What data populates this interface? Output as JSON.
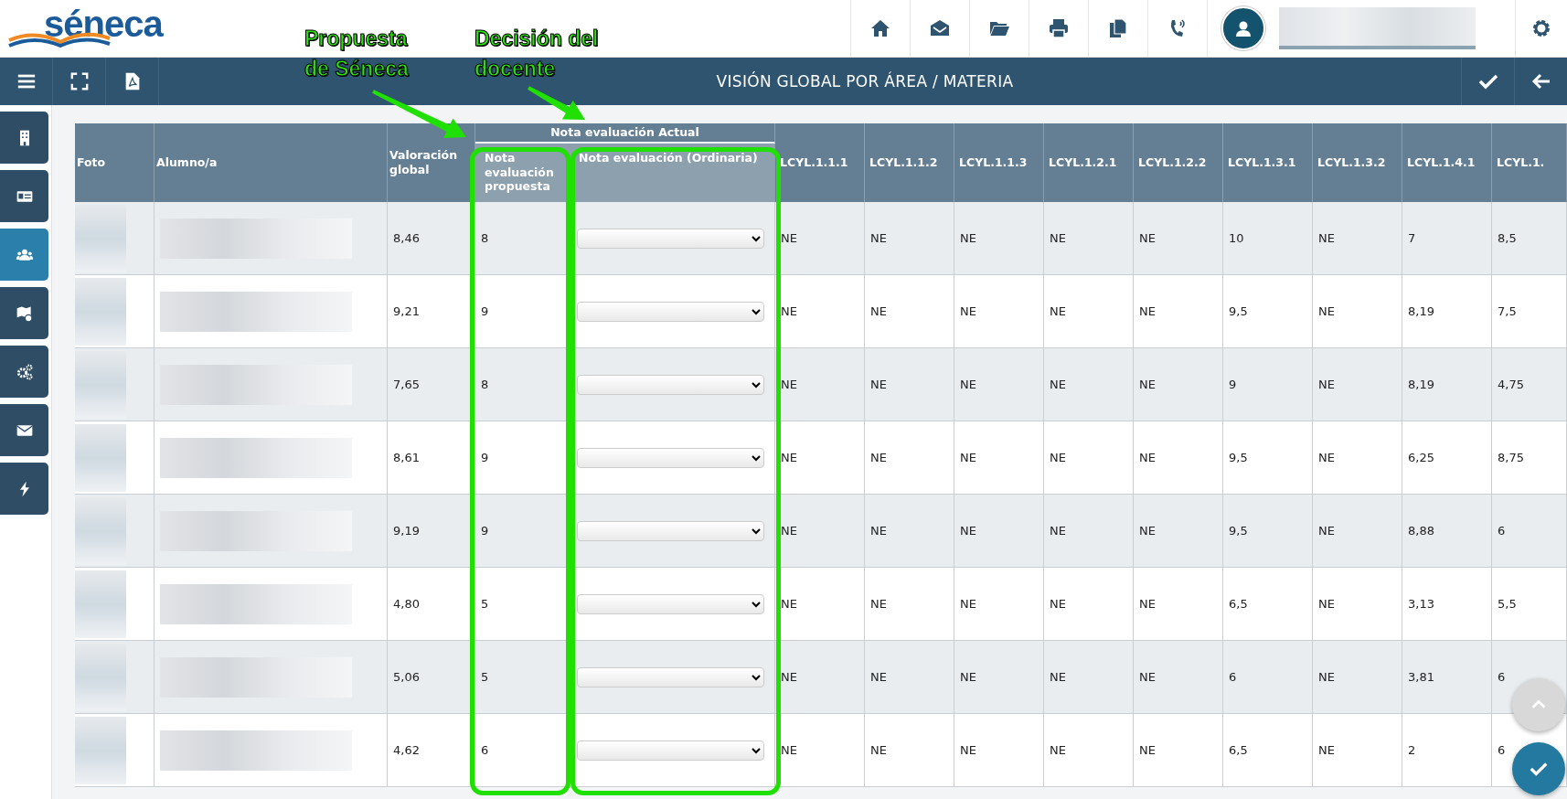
{
  "header": {
    "logo_text": "séneca"
  },
  "navbar": {
    "title": "VISIÓN GLOBAL POR ÁREA / MATERIA"
  },
  "sidebar": {
    "items": [
      {
        "selected": false
      },
      {
        "selected": false
      },
      {
        "selected": true
      },
      {
        "selected": false
      },
      {
        "selected": false
      },
      {
        "selected": false
      },
      {
        "selected": false
      }
    ]
  },
  "table": {
    "group_header": "Nota evaluación Actual",
    "columns": [
      "Foto",
      "Alumno/a",
      "Valoración global",
      "Nota evaluación propuesta",
      "Nota evaluación (Ordinaria)",
      "LCYL.1.1.1",
      "LCYL.1.1.2",
      "LCYL.1.1.3",
      "LCYL.1.2.1",
      "LCYL.1.2.2",
      "LCYL.1.3.1",
      "LCYL.1.3.2",
      "LCYL.1.4.1",
      "LCYL.1."
    ],
    "rows": [
      {
        "valoracion": "8,46",
        "propuesta": "8",
        "criteria": [
          "NE",
          "NE",
          "NE",
          "NE",
          "NE",
          "10",
          "NE",
          "7",
          "8,5"
        ]
      },
      {
        "valoracion": "9,21",
        "propuesta": "9",
        "criteria": [
          "NE",
          "NE",
          "NE",
          "NE",
          "NE",
          "9,5",
          "NE",
          "8,19",
          "7,5"
        ]
      },
      {
        "valoracion": "7,65",
        "propuesta": "8",
        "criteria": [
          "NE",
          "NE",
          "NE",
          "NE",
          "NE",
          "9",
          "NE",
          "8,19",
          "4,75"
        ]
      },
      {
        "valoracion": "8,61",
        "propuesta": "9",
        "criteria": [
          "NE",
          "NE",
          "NE",
          "NE",
          "NE",
          "9,5",
          "NE",
          "6,25",
          "8,75"
        ]
      },
      {
        "valoracion": "9,19",
        "propuesta": "9",
        "criteria": [
          "NE",
          "NE",
          "NE",
          "NE",
          "NE",
          "9,5",
          "NE",
          "8,88",
          "6"
        ]
      },
      {
        "valoracion": "4,80",
        "propuesta": "5",
        "criteria": [
          "NE",
          "NE",
          "NE",
          "NE",
          "NE",
          "6,5",
          "NE",
          "3,13",
          "5,5"
        ]
      },
      {
        "valoracion": "5,06",
        "propuesta": "5",
        "criteria": [
          "NE",
          "NE",
          "NE",
          "NE",
          "NE",
          "6",
          "NE",
          "3,81",
          "6"
        ]
      },
      {
        "valoracion": "4,62",
        "propuesta": "6",
        "criteria": [
          "NE",
          "NE",
          "NE",
          "NE",
          "NE",
          "6,5",
          "NE",
          "2",
          "6"
        ]
      }
    ]
  },
  "annotations": [
    {
      "text": "Propuesta de Séneca"
    },
    {
      "text": "Decisión del docente"
    }
  ]
}
